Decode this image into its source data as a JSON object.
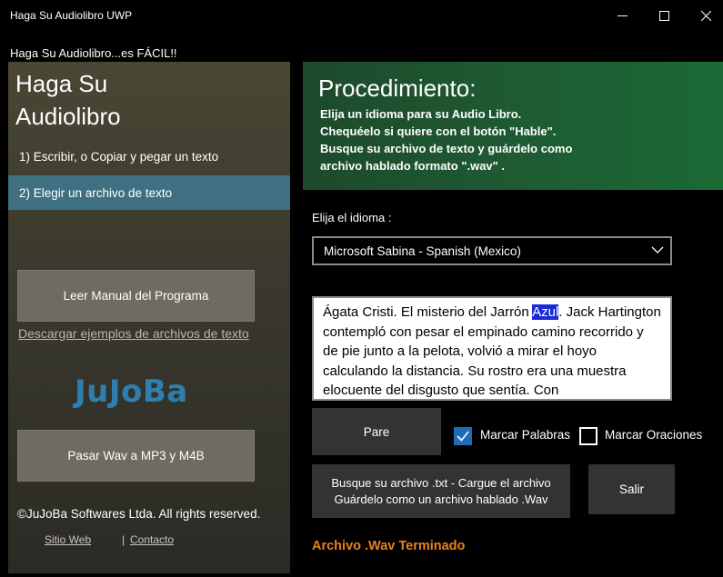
{
  "window": {
    "title": "Haga Su Audiolibro UWP",
    "subtitle": "Haga Su Audiolibro...es FÁCIL!!"
  },
  "sidebar": {
    "title": "Haga Su Audiolibro",
    "nav": [
      {
        "label": "1) Escribir, o Copiar y pegar un texto"
      },
      {
        "label": "2) Elegir un archivo de texto"
      }
    ],
    "manual_button": "Leer Manual del Programa",
    "download_link": "Descargar ejemplos de archivos de texto",
    "logo": "JuJoBa",
    "wav_button": "Pasar Wav a MP3 y M4B",
    "copyright": "©JuJoBa Softwares Ltda. All rights reserved.",
    "site_link": "Sitio Web",
    "separator": "|",
    "contact_link": "Contacto"
  },
  "procedure": {
    "title": "Procedimiento:",
    "lines": [
      "Elija un idioma para su Audio Libro.",
      "Chequéelo si quiere con el botón \"Hable\".",
      "Busque su archivo de texto y guárdelo como",
      "archivo hablado formato \".wav\" ."
    ]
  },
  "language": {
    "label": "Elija el idioma :",
    "selected": "Microsoft Sabina - Spanish (Mexico)"
  },
  "text": {
    "before": "Ágata Cristi.  El misterio del Jarrón ",
    "highlight": "Azul",
    "after": ".  Jack Hartington contempló con pesar el empinado camino recorrido y de pie junto a la pelota, volvió a mirar el hoyo calculando la distancia.  Su rostro era una muestra elocuente del disgusto que sentía. Con"
  },
  "controls": {
    "stop_button": "Pare",
    "mark_words": "Marcar Palabras",
    "mark_words_checked": true,
    "mark_sentences": "Marcar Oraciones",
    "mark_sentences_checked": false,
    "browse_line1": "Busque su archivo .txt - Cargue el archivo",
    "browse_line2": "Guárdelo como un archivo hablado .Wav",
    "exit_button": "Salir"
  },
  "status": "Archivo .Wav Terminado",
  "colors": {
    "accent_blue": "#3e7082",
    "procedure_green": "#1e5a32",
    "status_orange": "#e8821e",
    "logo_blue": "#2e7fb0",
    "checkbox_blue": "#1e6bb8"
  }
}
